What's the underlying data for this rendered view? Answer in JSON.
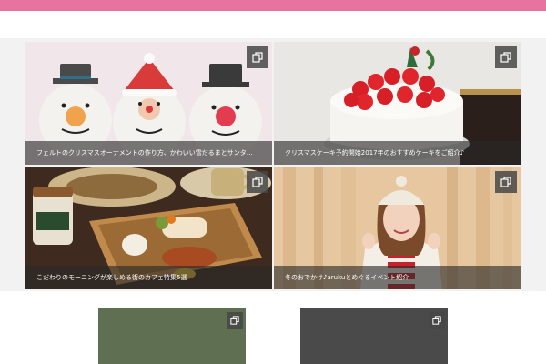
{
  "header": {
    "accent_color": "#e7739e"
  },
  "gallery": {
    "tiles": [
      {
        "caption": "フェルトのクリスマスオーナメントの作り方、かわいい雪だるまとサンタ…",
        "icon": "copy-icon"
      },
      {
        "caption": "クリスマスケーキ予約開始2017年のおすすめケーキをご紹介♪",
        "icon": "copy-icon"
      },
      {
        "caption": "こだわりのモーニングが楽しめる街のカフェ特集5選",
        "icon": "copy-icon"
      },
      {
        "caption": "冬のおでかけ♪arukuとめぐるイベント紹介",
        "icon": "copy-icon"
      }
    ]
  },
  "cards": [
    {
      "color": "#5f6f52",
      "icon": "copy-icon"
    },
    {
      "color": "#4a4a4a",
      "icon": "copy-icon"
    }
  ]
}
